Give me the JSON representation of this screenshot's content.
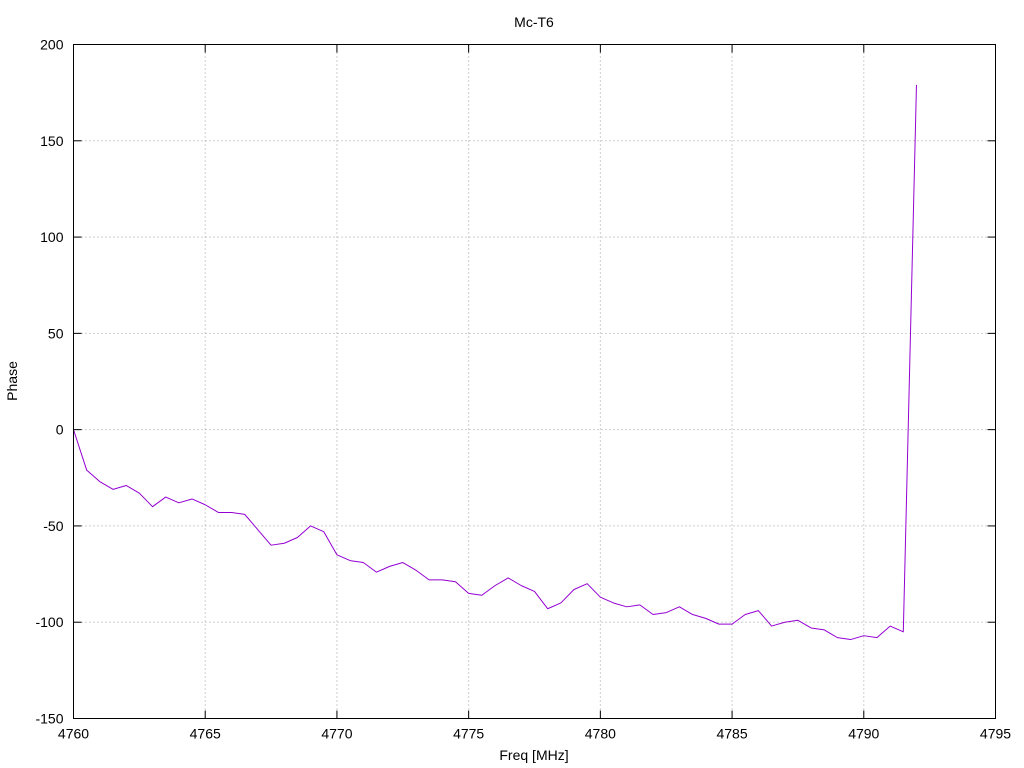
{
  "chart_data": {
    "type": "line",
    "title": "Mc-T6",
    "xlabel": "Freq [MHz]",
    "ylabel": "Phase",
    "xlim": [
      4760,
      4795
    ],
    "ylim": [
      -150,
      200
    ],
    "xticks": [
      4760,
      4765,
      4770,
      4775,
      4780,
      4785,
      4790,
      4795
    ],
    "yticks": [
      -150,
      -100,
      -50,
      0,
      50,
      100,
      150,
      200
    ],
    "grid": true,
    "series": [
      {
        "color": "#9400d3",
        "x": [
          4760,
          4760.5,
          4761,
          4761.5,
          4762,
          4762.5,
          4763,
          4763.5,
          4764,
          4764.5,
          4765,
          4765.5,
          4766,
          4766.5,
          4767,
          4767.5,
          4768,
          4768.5,
          4769,
          4769.5,
          4770,
          4770.5,
          4771,
          4771.5,
          4772,
          4772.5,
          4773,
          4773.5,
          4774,
          4774.5,
          4775,
          4775.5,
          4776,
          4776.5,
          4777,
          4777.5,
          4778,
          4778.5,
          4779,
          4779.5,
          4780,
          4780.5,
          4781,
          4781.5,
          4782,
          4782.5,
          4783,
          4783.5,
          4784,
          4784.5,
          4785,
          4785.5,
          4786,
          4786.5,
          4787,
          4787.5,
          4788,
          4788.5,
          4789,
          4789.5,
          4790,
          4790.5,
          4791,
          4791.5,
          4792
        ],
        "y": [
          0,
          -21,
          -27,
          -31,
          -29,
          -33,
          -40,
          -35,
          -38,
          -36,
          -39,
          -43,
          -43,
          -44,
          -52,
          -60,
          -59,
          -56,
          -50,
          -53,
          -65,
          -68,
          -69,
          -74,
          -71,
          -69,
          -73,
          -78,
          -78,
          -79,
          -85,
          -86,
          -81,
          -77,
          -81,
          -84,
          -93,
          -90,
          -83,
          -80,
          -87,
          -90,
          -92,
          -91,
          -96,
          -95,
          -92,
          -96,
          -98,
          -101,
          -101,
          -96,
          -94,
          -102,
          -100,
          -99,
          -103,
          -104,
          -108,
          -109,
          -107,
          -108,
          -102,
          -105,
          179
        ]
      }
    ]
  }
}
